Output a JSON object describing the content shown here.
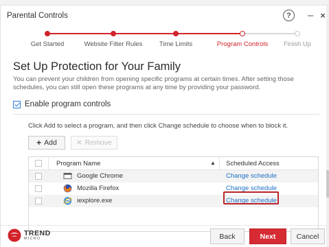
{
  "window": {
    "title": "Parental Controls",
    "controls": {
      "help": "?",
      "minimize": "–",
      "close": "×"
    }
  },
  "steps": [
    {
      "label": "Get Started",
      "state": "done"
    },
    {
      "label": "Website Filter Rules",
      "state": "done"
    },
    {
      "label": "Time Limits",
      "state": "done"
    },
    {
      "label": "Program Controls",
      "state": "current"
    },
    {
      "label": "Finish Up",
      "state": "todo"
    }
  ],
  "content": {
    "heading": "Set Up Protection for Your Family",
    "description": "You can prevent your children from opening specific programs at certain times. After setting those schedules, you can still open these programs at any time by providing your password.",
    "enable_label": "Enable program controls",
    "enable_checked": true,
    "instruction": "Click Add to select a program, and then click Change schedule to choose when to block it.",
    "add_label": "Add",
    "remove_label": "Remove"
  },
  "table": {
    "headers": {
      "program": "Program Name",
      "access": "Scheduled Access"
    },
    "rows": [
      {
        "name": "Google Chrome",
        "icon": "chrome-window-icon",
        "action": "Change schedule"
      },
      {
        "name": "Mozilla Firefox",
        "icon": "firefox-icon",
        "action": "Change schedule"
      },
      {
        "name": "iexplore.exe",
        "icon": "internet-explorer-icon",
        "action": "Change schedule"
      }
    ]
  },
  "footer": {
    "brand_top": "TREND",
    "brand_bottom": "MICRO",
    "back_label": "Back",
    "next_label": "Next",
    "cancel_label": "Cancel"
  },
  "colors": {
    "accent_red": "#d2232a",
    "link_blue": "#1d6fc4",
    "checkbox_blue": "#2b78d4"
  }
}
